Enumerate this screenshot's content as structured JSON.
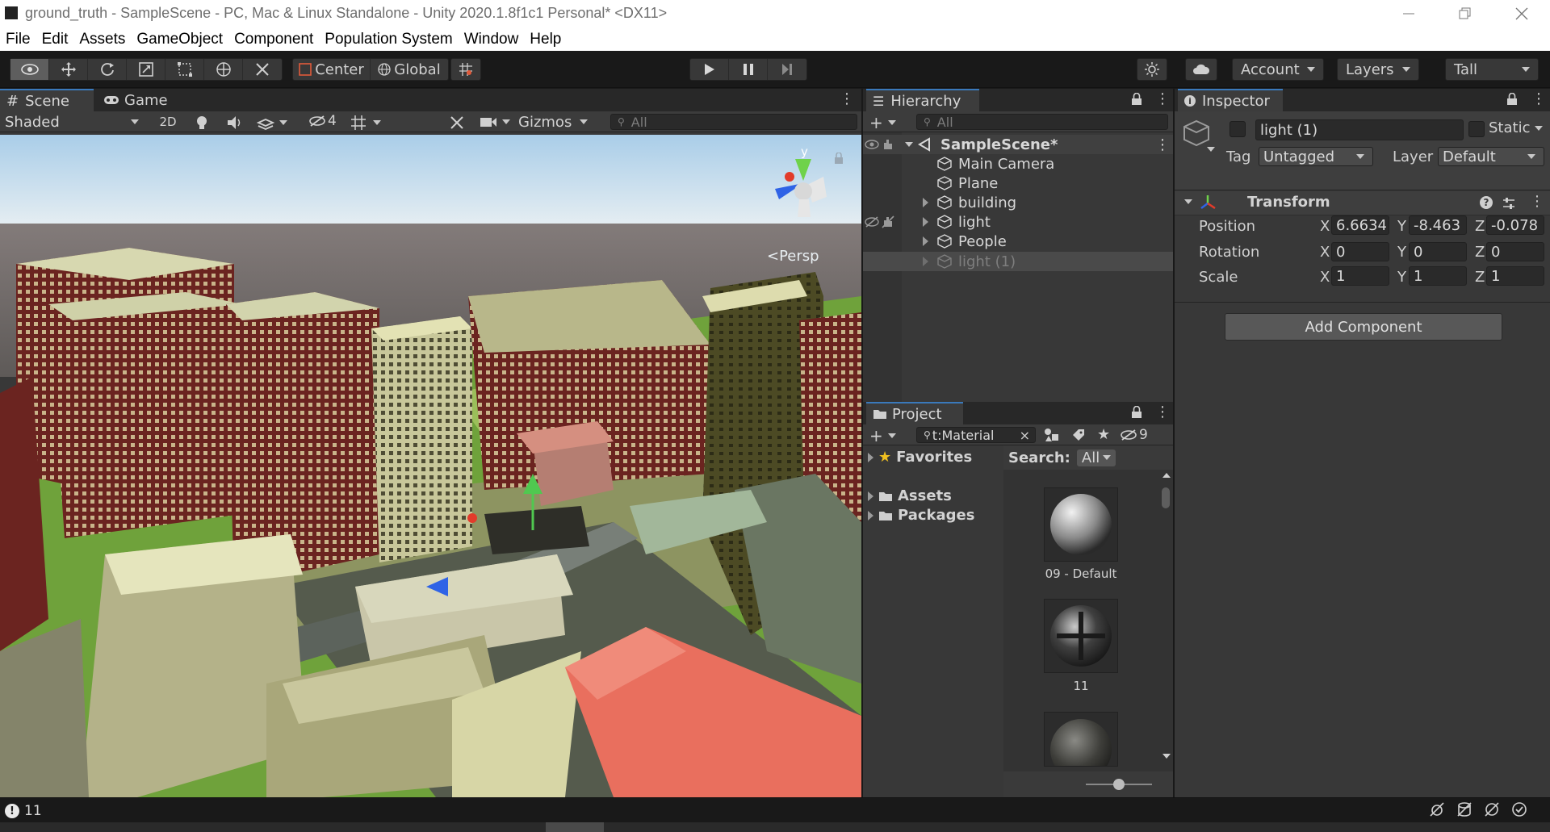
{
  "window": {
    "title": "ground_truth - SampleScene - PC, Mac & Linux Standalone - Unity 2020.1.8f1c1 Personal* <DX11>"
  },
  "menu": [
    "File",
    "Edit",
    "Assets",
    "GameObject",
    "Component",
    "Population System",
    "Window",
    "Help"
  ],
  "toolbar": {
    "pivot_label": "Center",
    "space_label": "Global",
    "account_label": "Account",
    "layers_label": "Layers",
    "layout_label": "Tall"
  },
  "scene": {
    "tabs": [
      "Scene",
      "Game"
    ],
    "shading_mode": "Shaded",
    "mode_2d": "2D",
    "hidden_count": "4",
    "gizmos_label": "Gizmos",
    "search_placeholder": "All",
    "persp_label": "<Persp",
    "gizmo_axis_y": "y"
  },
  "hierarchy": {
    "title": "Hierarchy",
    "search_placeholder": "All",
    "scene_name": "SampleScene*",
    "items": [
      {
        "label": "Main Camera",
        "expandable": false
      },
      {
        "label": "Plane",
        "expandable": false
      },
      {
        "label": "building",
        "expandable": true
      },
      {
        "label": "light",
        "expandable": true
      },
      {
        "label": "People",
        "expandable": true
      },
      {
        "label": "light (1)",
        "expandable": true,
        "selected": true,
        "disabled": true
      }
    ]
  },
  "project": {
    "title": "Project",
    "search_value": "t:Material",
    "hidden_count": "9",
    "tree": [
      "Favorites",
      "Assets",
      "Packages"
    ],
    "search_label": "Search:",
    "search_scope": "All",
    "assets": [
      {
        "label": "09 - Default"
      },
      {
        "label": "11"
      },
      {
        "label": ""
      }
    ]
  },
  "inspector": {
    "title": "Inspector",
    "object_name": "light (1)",
    "static_label": "Static",
    "tag_label": "Tag",
    "tag_value": "Untagged",
    "layer_label": "Layer",
    "layer_value": "Default",
    "component_title": "Transform",
    "position_label": "Position",
    "rotation_label": "Rotation",
    "scale_label": "Scale",
    "position": {
      "x": "6.6634",
      "y": "-8.463",
      "z": "-0.078"
    },
    "rotation": {
      "x": "0",
      "y": "0",
      "z": "0"
    },
    "scale": {
      "x": "1",
      "y": "1",
      "z": "1"
    },
    "add_component_label": "Add Component"
  },
  "status": {
    "message_count": "11"
  }
}
